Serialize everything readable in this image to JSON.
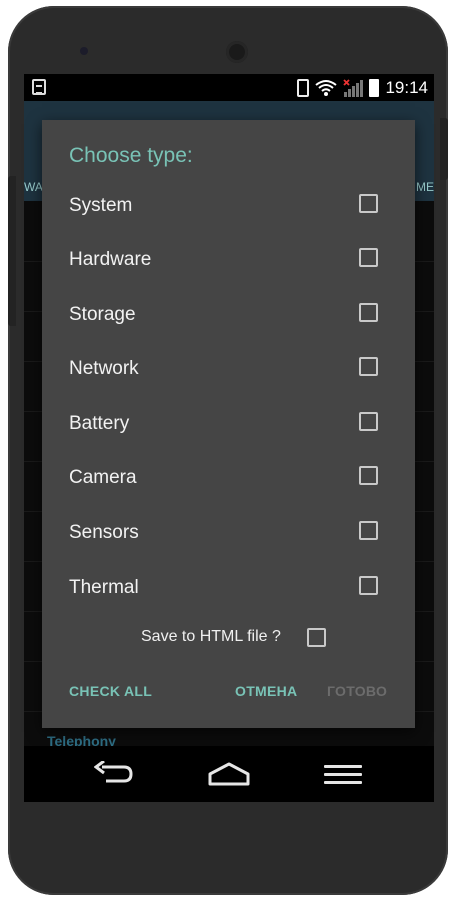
{
  "status_bar": {
    "time": "19:14",
    "icons": [
      "clipboard-icon",
      "rotation-lock-icon",
      "wifi-icon",
      "signal-icon",
      "battery-icon"
    ]
  },
  "background": {
    "tab_left_peek": "WA",
    "tab_right_peek": "ME",
    "telephony_label": "Telephony"
  },
  "dialog": {
    "title": "Choose type:",
    "options": [
      {
        "label": "System",
        "checked": false
      },
      {
        "label": "Hardware",
        "checked": false
      },
      {
        "label": "Storage",
        "checked": false
      },
      {
        "label": "Network",
        "checked": false
      },
      {
        "label": "Battery",
        "checked": false
      },
      {
        "label": "Camera",
        "checked": false
      },
      {
        "label": "Sensors",
        "checked": false
      },
      {
        "label": "Thermal",
        "checked": false
      }
    ],
    "save_to_html_label": "Save to HTML file ?",
    "save_to_html_checked": false,
    "check_all_label": "CHECK ALL",
    "cancel_label": "ОТМЕНА",
    "done_label": "ГОТОВО",
    "done_enabled": false
  },
  "navbar": {
    "icons": [
      "back-icon",
      "home-icon",
      "recent-apps-icon"
    ]
  },
  "colors": {
    "accent": "#79c3b6",
    "dialog_bg": "#454545",
    "disabled_text": "#6c6c6c",
    "telephony_text": "#2e6f86"
  }
}
